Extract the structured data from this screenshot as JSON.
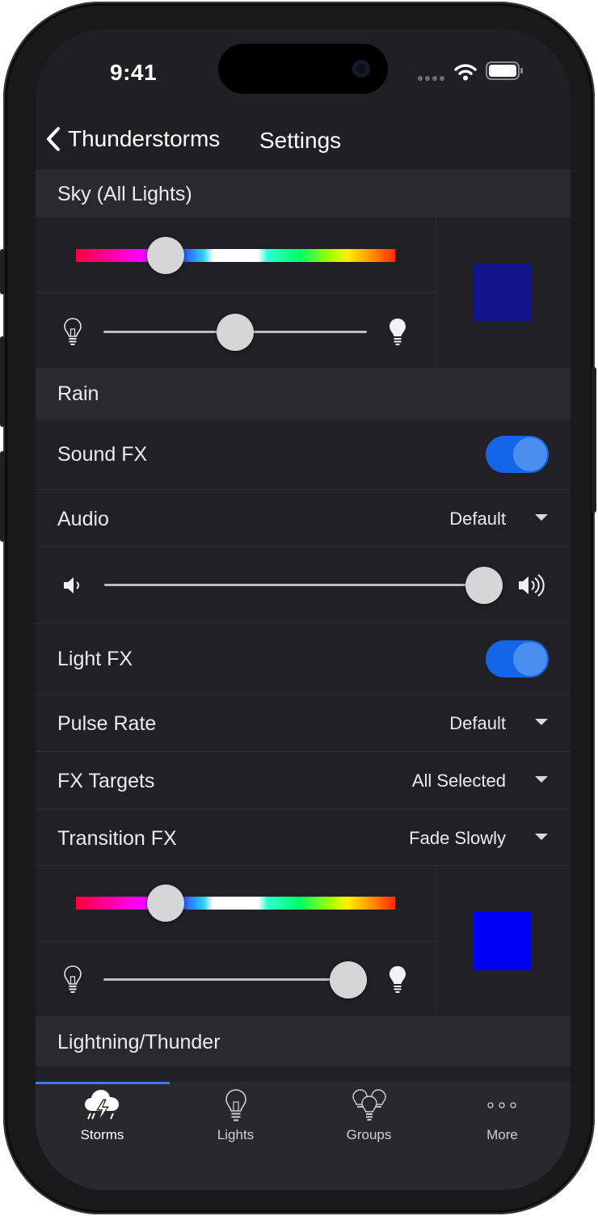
{
  "status_bar": {
    "time": "9:41"
  },
  "nav": {
    "back_label": "Thunderstorms",
    "title": "Settings"
  },
  "sections": {
    "sky": "Sky (All Lights)",
    "rain": "Rain",
    "lightning": "Lightning/Thunder"
  },
  "sky": {
    "hue_fraction": 0.28,
    "brightness_fraction": 0.5,
    "swatch_color": "#14148c"
  },
  "rain": {
    "sound_fx": {
      "label": "Sound FX",
      "on": true
    },
    "audio": {
      "label": "Audio",
      "value": "Default"
    },
    "volume_fraction": 1.0,
    "light_fx": {
      "label": "Light FX",
      "on": true
    },
    "pulse_rate": {
      "label": "Pulse Rate",
      "value": "Default"
    },
    "fx_targets": {
      "label": "FX Targets",
      "value": "All Selected"
    },
    "transition_fx": {
      "label": "Transition FX",
      "value": "Fade Slowly"
    },
    "hue_fraction": 0.28,
    "brightness_fraction": 0.93,
    "swatch_color": "#0000f5"
  },
  "tabs": [
    {
      "label": "Storms",
      "icon": "storm-cloud-icon",
      "active": true
    },
    {
      "label": "Lights",
      "icon": "lightbulb-icon",
      "active": false
    },
    {
      "label": "Groups",
      "icon": "bulb-group-icon",
      "active": false
    },
    {
      "label": "More",
      "icon": "more-dots-icon",
      "active": false
    }
  ],
  "colors": {
    "accent": "#1565e8",
    "background": "#212125",
    "section": "#29292e"
  }
}
